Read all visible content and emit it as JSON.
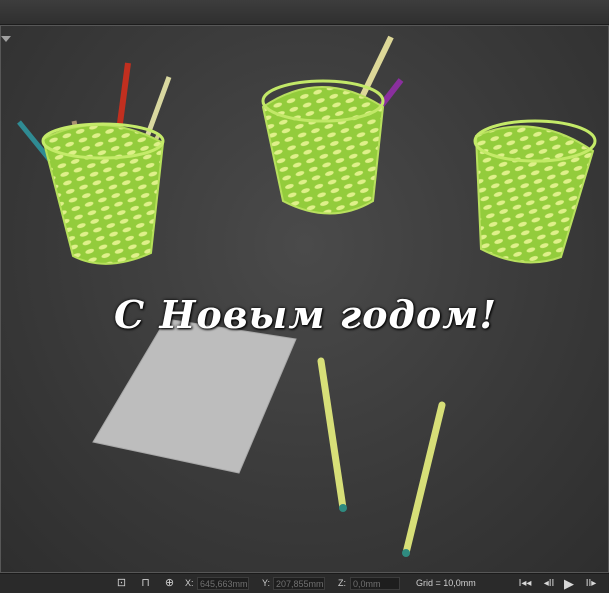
{
  "scene": {
    "greeting": "С Новым годом!"
  },
  "statusbar": {
    "x_label": "X:",
    "x_value": "645,663mm",
    "y_label": "Y:",
    "y_value": "207,855mm",
    "z_label": "Z:",
    "z_value": "0,0mm",
    "grid": "Grid = 10,0mm"
  },
  "colors": {
    "viewport_bg": "#3c3c3c",
    "basket_green": "#8bc43a",
    "paper": "#bcbcbc",
    "pencil_yellow": "#d8e07a"
  },
  "icons": {
    "viewport_menu": "triangle-down-icon",
    "selection": "selection-lock-icon",
    "lock": "lock-icon",
    "absolute_mode": "absolute-mode-icon",
    "goto_start": "go-to-start-icon",
    "prev_frame": "previous-frame-icon",
    "play": "play-icon",
    "next_frame": "next-frame-icon"
  },
  "playback": {
    "goto_start": "I◂◂",
    "prev_frame": "◂II",
    "play": "▶",
    "next_frame": "II▸"
  }
}
